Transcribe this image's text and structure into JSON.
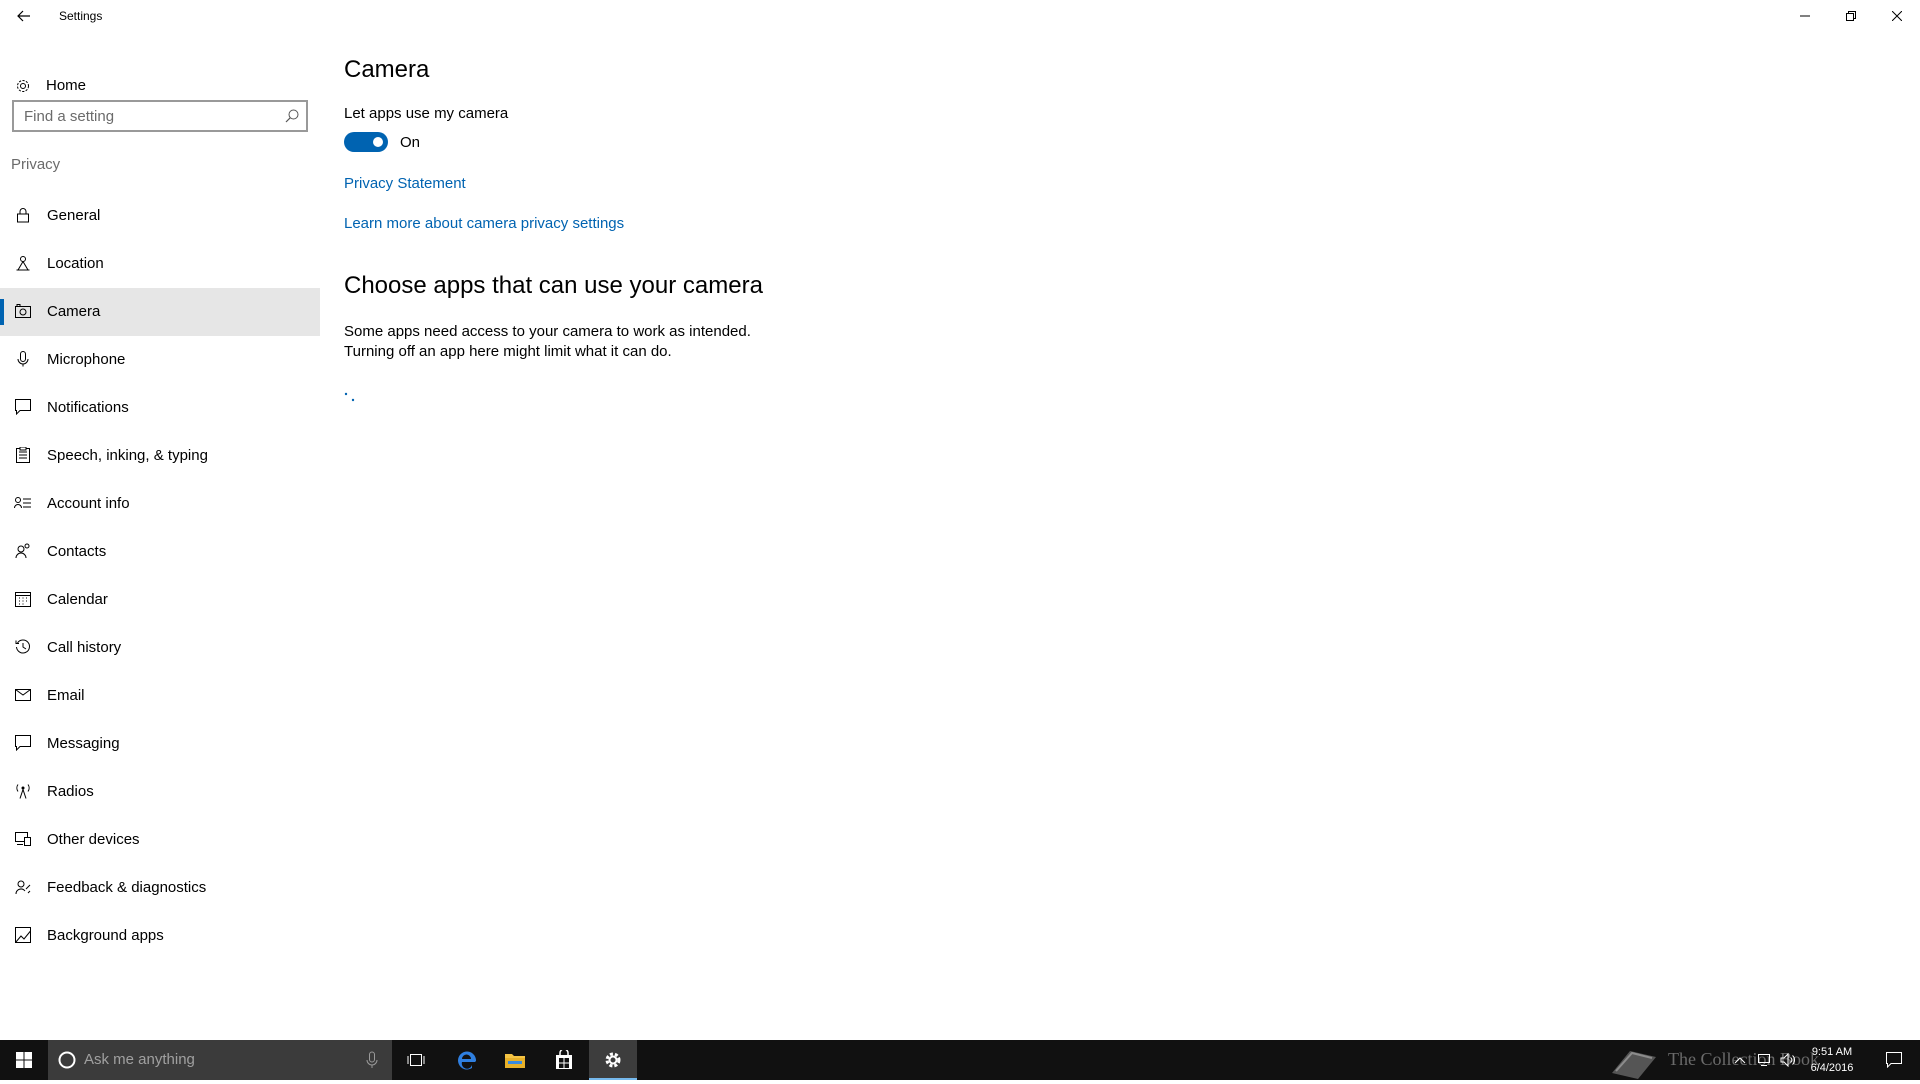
{
  "window": {
    "title": "Settings",
    "back_icon": "back-arrow-icon",
    "controls": [
      "minimize-icon",
      "restore-icon",
      "close-icon"
    ]
  },
  "sidebar": {
    "home_label": "Home",
    "search_placeholder": "Find a setting",
    "section_label": "Privacy",
    "items": [
      {
        "label": "General",
        "icon": "lock-icon",
        "selected": false
      },
      {
        "label": "Location",
        "icon": "location-icon",
        "selected": false
      },
      {
        "label": "Camera",
        "icon": "camera-icon",
        "selected": true
      },
      {
        "label": "Microphone",
        "icon": "microphone-icon",
        "selected": false
      },
      {
        "label": "Notifications",
        "icon": "notifications-icon",
        "selected": false
      },
      {
        "label": "Speech, inking, & typing",
        "icon": "clipboard-icon",
        "selected": false
      },
      {
        "label": "Account info",
        "icon": "account-info-icon",
        "selected": false
      },
      {
        "label": "Contacts",
        "icon": "contacts-icon",
        "selected": false
      },
      {
        "label": "Calendar",
        "icon": "calendar-icon",
        "selected": false
      },
      {
        "label": "Call history",
        "icon": "history-icon",
        "selected": false
      },
      {
        "label": "Email",
        "icon": "email-icon",
        "selected": false
      },
      {
        "label": "Messaging",
        "icon": "message-icon",
        "selected": false
      },
      {
        "label": "Radios",
        "icon": "radio-tower-icon",
        "selected": false
      },
      {
        "label": "Other devices",
        "icon": "devices-icon",
        "selected": false
      },
      {
        "label": "Feedback & diagnostics",
        "icon": "feedback-icon",
        "selected": false
      },
      {
        "label": "Background apps",
        "icon": "background-apps-icon",
        "selected": false
      }
    ]
  },
  "main": {
    "title": "Camera",
    "toggle_label": "Let apps use my camera",
    "toggle_state": "On",
    "privacy_link": "Privacy Statement",
    "learn_more_link": "Learn more about camera privacy settings",
    "section_title": "Choose apps that can use your camera",
    "description_line1": "Some apps need access to your camera to work as intended.",
    "description_line2": "Turning off an app here might limit what it can do."
  },
  "taskbar": {
    "search_placeholder": "Ask me anything",
    "clock_time": "9:51 AM",
    "clock_date": "6/4/2016",
    "watermark_text": "The Collection Book"
  },
  "colors": {
    "accent": "#0063b1",
    "selected_bg": "#e6e6e6",
    "taskbar_bg": "#111111"
  }
}
